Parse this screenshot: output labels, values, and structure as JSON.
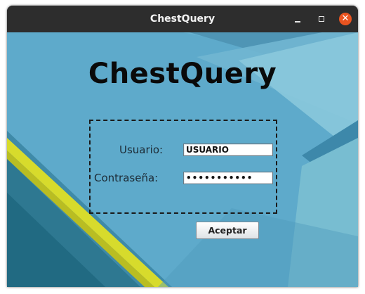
{
  "window": {
    "title": "ChestQuery",
    "controls": {
      "minimize_icon": "minimize-icon",
      "maximize_icon": "maximize-icon",
      "close_icon": "close-icon",
      "close_glyph": "✕"
    }
  },
  "app": {
    "logo_text": "ChestQuery"
  },
  "login": {
    "username_label": "Usuario:",
    "username_value": "USUARIO",
    "password_label": "Contraseña:",
    "password_masked": "•••••••••••",
    "submit_label": "Aceptar"
  },
  "colors": {
    "titlebar": "#2d2d2d",
    "close_button": "#e95420",
    "background_primary": "#5ca9c9",
    "background_dark": "#2b7691",
    "accent_stripe": "#d9dc2e"
  }
}
